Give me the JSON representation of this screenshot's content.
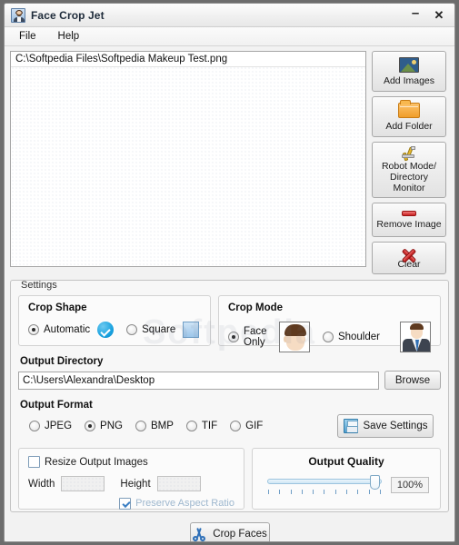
{
  "window": {
    "title": "Face Crop Jet",
    "icon": "app-person-icon",
    "minimize_label": "–",
    "close_label": "✕"
  },
  "menubar": {
    "items": [
      {
        "label": "File"
      },
      {
        "label": "Help"
      }
    ]
  },
  "file_list": {
    "items": [
      {
        "path": "C:\\Softpedia Files\\Softpedia Makeup Test.png"
      }
    ]
  },
  "side_buttons": [
    {
      "label": "Add Images",
      "icon": "image-icon"
    },
    {
      "label": "Add Folder",
      "icon": "folder-icon"
    },
    {
      "label": "Robot Mode/\nDirectory Monitor",
      "icon": "robot-arm-icon"
    },
    {
      "label": "Remove Image",
      "icon": "minus-icon"
    },
    {
      "label": "Clear",
      "icon": "red-x-icon"
    }
  ],
  "settings": {
    "legend": "Settings",
    "crop_shape": {
      "title": "Crop Shape",
      "options": [
        {
          "label": "Automatic",
          "selected": true,
          "icon": "blue-check-icon"
        },
        {
          "label": "Square",
          "selected": false,
          "icon": "blue-square-icon"
        }
      ]
    },
    "crop_mode": {
      "title": "Crop Mode",
      "options": [
        {
          "label": "Face Only",
          "selected": true,
          "icon": "face-thumbnail"
        },
        {
          "label": "Shoulder",
          "selected": false,
          "icon": "bust-thumbnail"
        }
      ]
    },
    "output_directory": {
      "title": "Output Directory",
      "value": "C:\\Users\\Alexandra\\Desktop",
      "placeholder": "",
      "browse_label": "Browse"
    },
    "output_format": {
      "title": "Output Format",
      "options": [
        {
          "label": "JPEG",
          "selected": false
        },
        {
          "label": "PNG",
          "selected": true
        },
        {
          "label": "BMP",
          "selected": false
        },
        {
          "label": "TIF",
          "selected": false
        },
        {
          "label": "GIF",
          "selected": false
        }
      ],
      "save_settings_label": "Save Settings",
      "save_settings_icon": "floppy-disk-icon"
    },
    "resize": {
      "enable_label": "Resize Output Images",
      "enabled": false,
      "width_label": "Width",
      "width_value": "",
      "height_label": "Height",
      "height_value": "",
      "preserve_label": "Preserve Aspect Ratio",
      "preserve_checked": true
    },
    "quality": {
      "title": "Output Quality",
      "value_label": "100%",
      "percent": 100,
      "tick_count": 11
    }
  },
  "actions": {
    "crop_faces_label": "Crop Faces",
    "crop_faces_icon": "scissors-icon"
  },
  "watermark": {
    "text": "Softpedia"
  },
  "colors": {
    "accent_blue": "#1aa3e0",
    "button_face": "#ececec",
    "window_bg": "#f2f2f2",
    "danger_red": "#bd1111"
  }
}
